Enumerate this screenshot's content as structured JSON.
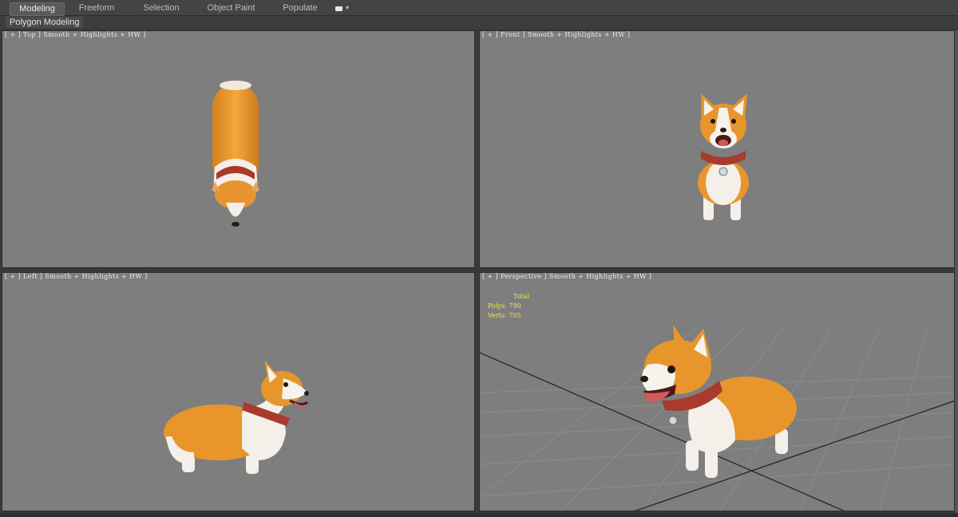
{
  "ribbon": {
    "tabs": [
      {
        "label": "Modeling",
        "active": true
      },
      {
        "label": "Freeform"
      },
      {
        "label": "Selection"
      },
      {
        "label": "Object Paint"
      },
      {
        "label": "Populate"
      }
    ],
    "options_icon": "dropdown-box-icon",
    "panel_title": "Polygon Modeling"
  },
  "viewports": {
    "top": {
      "label": "[ + ] Top ] Smooth + Highlights + HW ]"
    },
    "front": {
      "label": "[ + ] Front ] Smooth + Highlights + HW ]"
    },
    "left": {
      "label": "[ + ] Left ] Smooth + Highlights + HW ]"
    },
    "persp": {
      "label": "[ + ] Perspective ] Smooth + Highlights + HW ]",
      "stats": {
        "header": "Total",
        "polys": "Polys: 790",
        "verts": "Verts: 705"
      }
    }
  },
  "colors": {
    "viewport_bg": "#7e7e7e",
    "fur_orange": "#e8962c",
    "fur_white": "#f5f1ec",
    "collar_red": "#a83a2e",
    "stats_yellow": "#f2e83c"
  }
}
